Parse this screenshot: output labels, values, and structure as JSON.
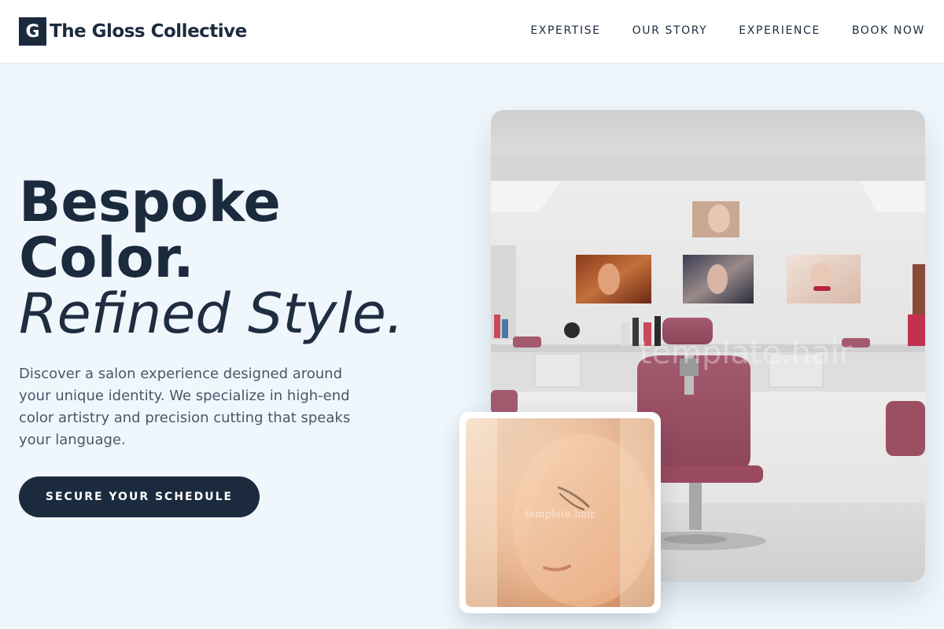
{
  "header": {
    "logo_mark": "G",
    "logo_text": "The Gloss Collective",
    "nav": [
      "EXPERTISE",
      "OUR STORY",
      "EXPERIENCE",
      "BOOK NOW"
    ]
  },
  "hero": {
    "headline_line1": "Bespoke",
    "headline_line2": "Color.",
    "headline_line3": "Refined Style.",
    "description": "Discover a salon experience designed around your unique identity. We specialize in high-end color artistry and precision cutting that speaks your language.",
    "cta_label": "SECURE YOUR SCHEDULE"
  },
  "images": {
    "main_watermark": "template.hair",
    "small_watermark": "template.hair"
  },
  "colors": {
    "primary": "#1c2a3e",
    "page_background": "#eff7fd",
    "header_background": "#ffffff",
    "body_text": "#4a5668"
  }
}
